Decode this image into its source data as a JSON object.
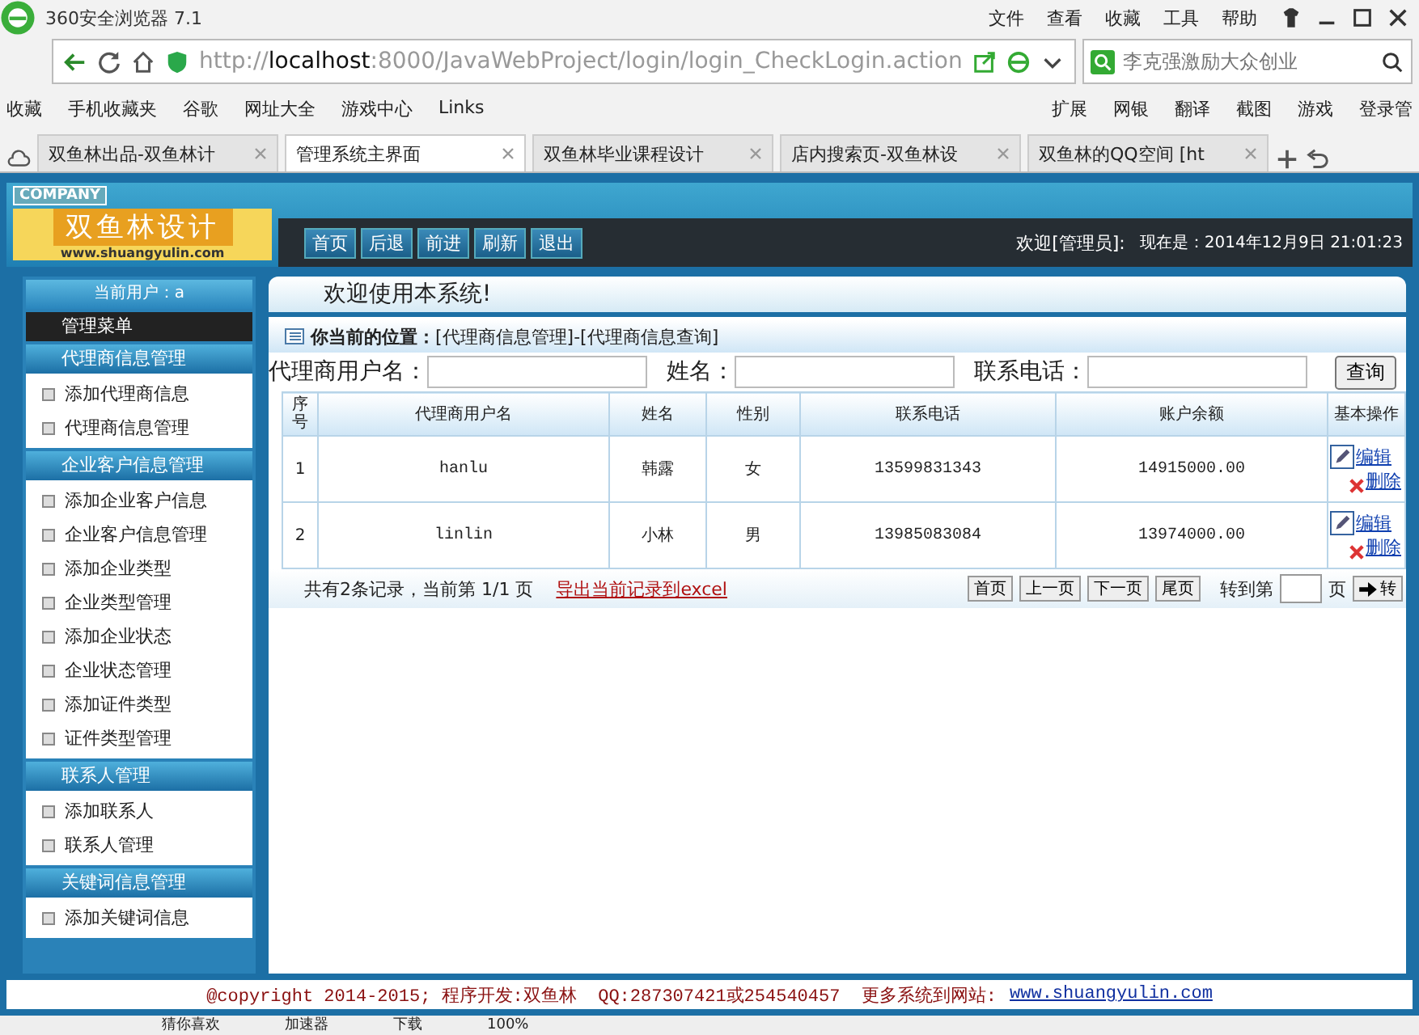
{
  "browser": {
    "title": "360安全浏览器 7.1",
    "menu": [
      "文件",
      "查看",
      "收藏",
      "工具",
      "帮助"
    ],
    "url": {
      "scheme": "http://",
      "host": "localhost",
      "path": ":8000/JavaWebProject/login/login_CheckLogin.action"
    },
    "search": {
      "placeholder": "李克强激励大众创业"
    },
    "bookmarks": [
      "收藏",
      "手机收藏夹",
      "谷歌",
      "网址大全",
      "游戏中心",
      "Links"
    ],
    "tools": [
      "扩展",
      "网银",
      "翻译",
      "截图",
      "游戏",
      "登录管"
    ],
    "tabs": [
      {
        "label": "双鱼林出品-双鱼林计",
        "selected": false
      },
      {
        "label": "管理系统主界面",
        "selected": true
      },
      {
        "label": "双鱼林毕业课程设计",
        "selected": false
      },
      {
        "label": "店内搜索页-双鱼林设",
        "selected": false
      },
      {
        "label": "双鱼林的QQ空间 [ht",
        "selected": false
      }
    ],
    "status_bar": [
      "猜你喜欢",
      "加速器",
      "下载",
      "100%"
    ]
  },
  "app": {
    "company": "COMPANY",
    "logo": "双鱼林设计",
    "logo_url": "www.shuangyulin.com",
    "nav": [
      "首页",
      "后退",
      "前进",
      "刷新",
      "退出"
    ],
    "welcome": "欢迎[管理员]:",
    "clock": "现在是：2014年12月9日 21:01:23",
    "current_user": "当前用户：a",
    "welcome_message": "欢迎使用本系统!",
    "menu_title": "管理菜单",
    "menu_groups": [
      {
        "title": "代理商信息管理",
        "items": [
          "添加代理商信息",
          "代理商信息管理"
        ]
      },
      {
        "title": "企业客户信息管理",
        "items": [
          "添加企业客户信息",
          "企业客户信息管理",
          "添加企业类型",
          "企业类型管理",
          "添加企业状态",
          "企业状态管理",
          "添加证件类型",
          "证件类型管理"
        ]
      },
      {
        "title": "联系人管理",
        "items": [
          "添加联系人",
          "联系人管理"
        ]
      },
      {
        "title": "关键词信息管理",
        "items": [
          "添加关键词信息"
        ]
      }
    ],
    "breadcrumb": {
      "label": "你当前的位置：",
      "path": "[代理商信息管理]-[代理商信息查询]"
    },
    "filters": [
      {
        "label": "代理商用户名："
      },
      {
        "label": "姓名："
      },
      {
        "label": "联系电话："
      }
    ],
    "query_button": "查询",
    "table": {
      "columns": [
        "序号",
        "代理商用户名",
        "姓名",
        "性别",
        "联系电话",
        "账户余额",
        "基本操作"
      ],
      "rows": [
        {
          "cells": [
            "1",
            "hanlu",
            "韩露",
            "女",
            "13599831343",
            "14915000.00"
          ],
          "actions": [
            "编辑",
            "删除"
          ]
        },
        {
          "cells": [
            "2",
            "linlin",
            "小林",
            "男",
            "13985083084",
            "13974000.00"
          ],
          "actions": [
            "编辑",
            "删除"
          ]
        }
      ]
    },
    "pager": {
      "summary": "共有2条记录，当前第 1/1 页",
      "export": "导出当前记录到excel",
      "buttons": [
        "首页",
        "上一页",
        "下一页",
        "尾页"
      ],
      "goto": "转到第",
      "page_unit": "页",
      "go": "转"
    },
    "footer": {
      "text": "@copyright 2014-2015; 程序开发:双鱼林  QQ:287307421或254540457  更多系统到网站:",
      "link": "www.shuangyulin.com"
    }
  }
}
